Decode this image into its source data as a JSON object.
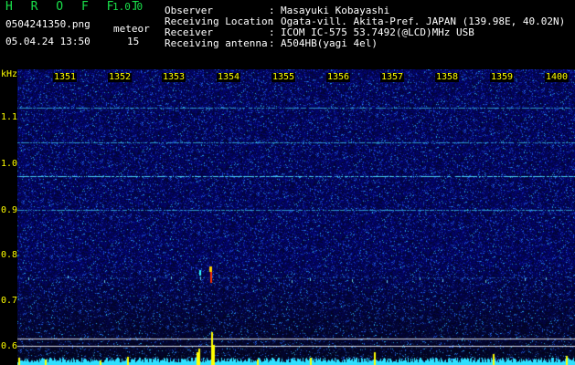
{
  "app": {
    "logo": "H R O F F T",
    "version": "1.0.0"
  },
  "file": {
    "name": "0504241350.png",
    "date_time": "05.04.24 13:50"
  },
  "meteor": {
    "label": "meteor",
    "count": "15"
  },
  "info": [
    {
      "label": "Observer",
      "sep": ":",
      "value": "Masayuki Kobayashi"
    },
    {
      "label": "Receiving Location",
      "sep": ":",
      "value": "Ogata-vill. Akita-Pref. JAPAN (139.98E, 40.02N)"
    },
    {
      "label": "Receiver",
      "sep": ":",
      "value": "ICOM IC-575 53.7492(@LCD)MHz USB"
    },
    {
      "label": "Receiving antenna",
      "sep": ":",
      "value": "A504HB(yagi 4el)"
    }
  ],
  "axis": {
    "unit": "kHz",
    "freq_ticks": [
      "1.1",
      "1.0",
      "0.9",
      "0.8",
      "0.7",
      "0.6"
    ],
    "time_ticks": [
      "1351",
      "1352",
      "1353",
      "1354",
      "1355",
      "1356",
      "1357",
      "1358",
      "1359",
      "1400"
    ]
  },
  "colors": {
    "text_white": "#ffffff",
    "text_yellow": "#ffff00",
    "logo_green": "#19e04a",
    "noise_base": "#0b0f7a",
    "signal_cyan": "#30e0ff"
  }
}
